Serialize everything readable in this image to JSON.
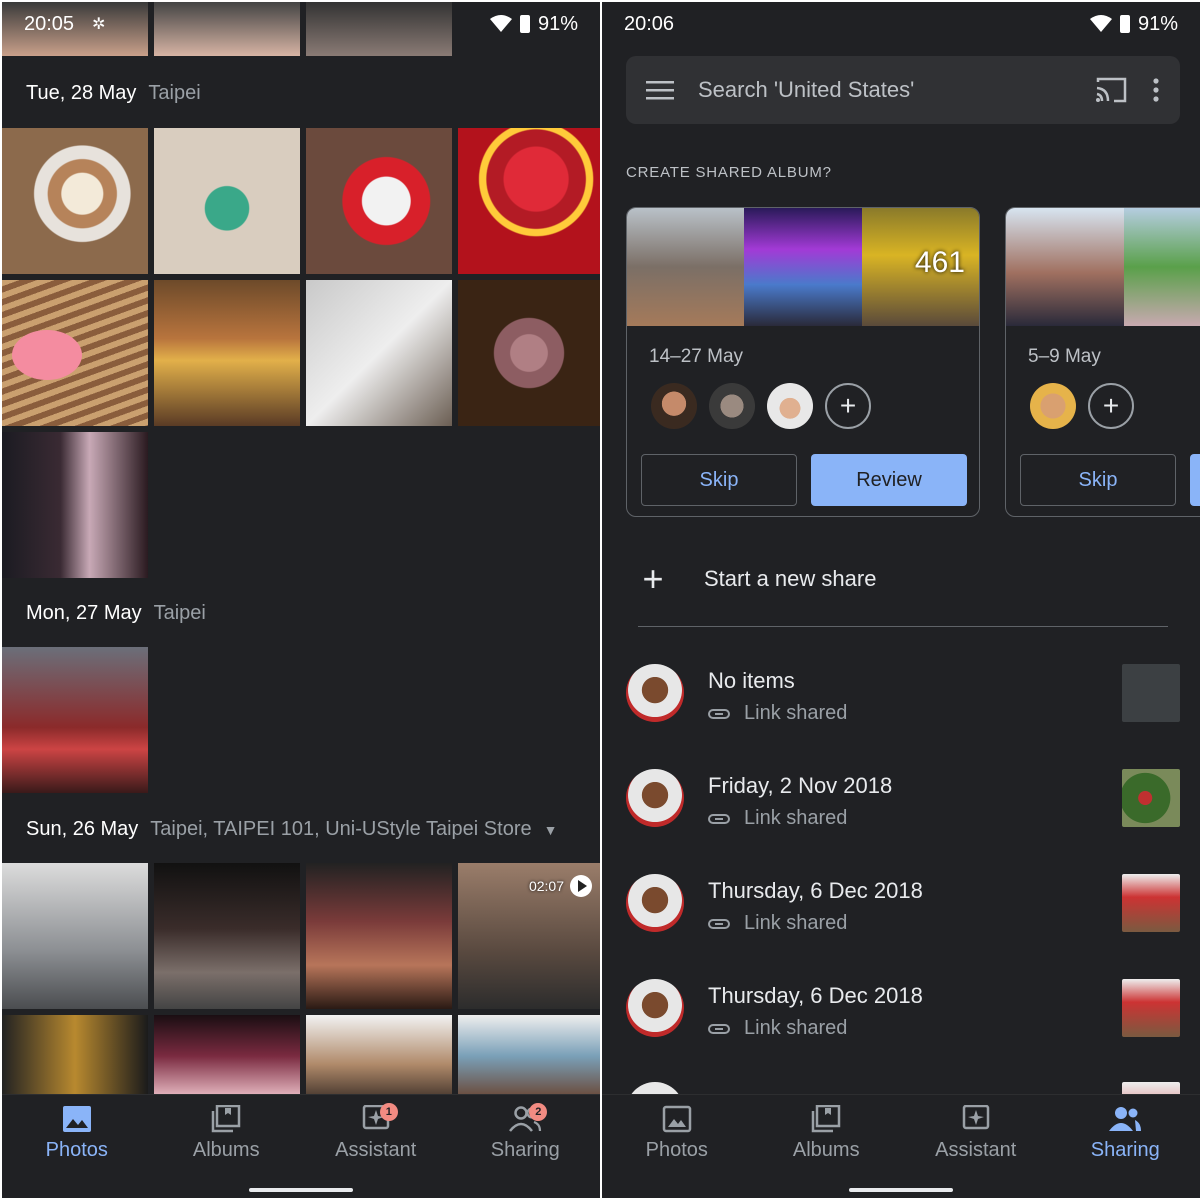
{
  "left_screen": {
    "status": {
      "time": "20:05",
      "battery": "91%"
    },
    "groups": [
      {
        "date": "Tue, 28 May",
        "location": "Taipei"
      },
      {
        "date": "Mon, 27 May",
        "location": "Taipei"
      },
      {
        "date": "Sun, 26 May",
        "location": "Taipei, TAIPEI 101, Uni-UStyle Taipei Store"
      }
    ],
    "video_duration": "02:07",
    "nav": [
      {
        "label": "Photos",
        "icon": "photo-icon",
        "active": true
      },
      {
        "label": "Albums",
        "icon": "albums-icon"
      },
      {
        "label": "Assistant",
        "icon": "assistant-icon",
        "badge": "1"
      },
      {
        "label": "Sharing",
        "icon": "sharing-icon",
        "badge": "2"
      }
    ]
  },
  "right_screen": {
    "status": {
      "time": "20:06",
      "battery": "91%"
    },
    "search": {
      "placeholder": "Search 'United States'"
    },
    "section_title": "CREATE SHARED ALBUM?",
    "cards": [
      {
        "photo_count": "461",
        "range": "14–27 May",
        "skip_label": "Skip",
        "review_label": "Review"
      },
      {
        "range": "5–9 May",
        "skip_label": "Skip"
      }
    ],
    "new_share_label": "Start a new share",
    "shares": [
      {
        "title": "No items",
        "subtitle": "Link shared"
      },
      {
        "title": "Friday, 2 Nov 2018",
        "subtitle": "Link shared"
      },
      {
        "title": "Thursday, 6 Dec 2018",
        "subtitle": "Link shared"
      },
      {
        "title": "Thursday, 6 Dec 2018",
        "subtitle": "Link shared"
      }
    ],
    "nav": [
      {
        "label": "Photos",
        "icon": "photo-icon"
      },
      {
        "label": "Albums",
        "icon": "albums-icon"
      },
      {
        "label": "Assistant",
        "icon": "assistant-icon"
      },
      {
        "label": "Sharing",
        "icon": "sharing-icon",
        "active": true
      }
    ]
  },
  "colors": {
    "background": "#202124",
    "accent": "#8ab4f8",
    "badge": "#f28b82"
  }
}
